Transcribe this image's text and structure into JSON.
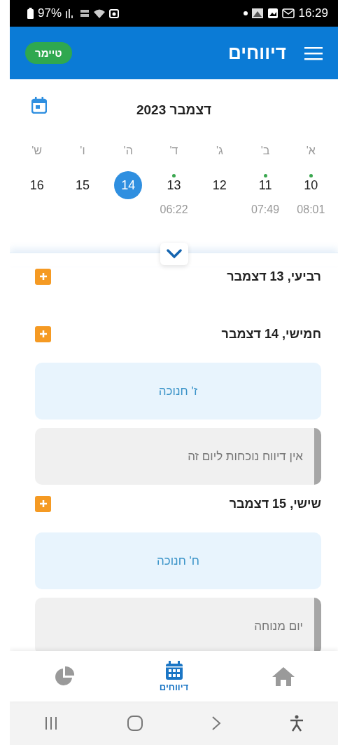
{
  "status_bar": {
    "battery": "97%",
    "time": "16:29"
  },
  "app_bar": {
    "title": "דיווחים",
    "timer_button": "טיימר"
  },
  "calendar": {
    "month": "דצמבר 2023",
    "weekdays": [
      "א'",
      "ב'",
      "ג'",
      "ד'",
      "ה'",
      "ו'",
      "ש'"
    ],
    "days": [
      {
        "number": "10",
        "selected": false,
        "has_report": true,
        "time": "08:01"
      },
      {
        "number": "11",
        "selected": false,
        "has_report": true,
        "time": "07:49"
      },
      {
        "number": "12",
        "selected": false,
        "has_report": false
      },
      {
        "number": "13",
        "selected": false,
        "has_report": true,
        "time": "06:22"
      },
      {
        "number": "14",
        "selected": true,
        "has_report": false
      },
      {
        "number": "15",
        "selected": false,
        "has_report": false
      },
      {
        "number": "16",
        "selected": false,
        "has_report": false
      }
    ]
  },
  "sections": [
    {
      "heading": "רביעי, 13 דצמבר"
    },
    {
      "heading": "חמישי, 14 דצמבר",
      "cards": [
        {
          "kind": "holiday",
          "text": "ז' חנוכה"
        },
        {
          "kind": "note",
          "text": "אין דיווח נוכחות ליום זה"
        }
      ]
    },
    {
      "heading": "שישי, 15 דצמבר",
      "cards": [
        {
          "kind": "holiday",
          "text": "ח' חנוכה"
        },
        {
          "kind": "note",
          "text": "יום מנוחה"
        }
      ]
    }
  ],
  "bottom_nav": [
    {
      "kind": "home",
      "selected": false
    },
    {
      "kind": "reports",
      "label": "דיווחים",
      "selected": true
    },
    {
      "kind": "stats",
      "selected": false
    }
  ]
}
